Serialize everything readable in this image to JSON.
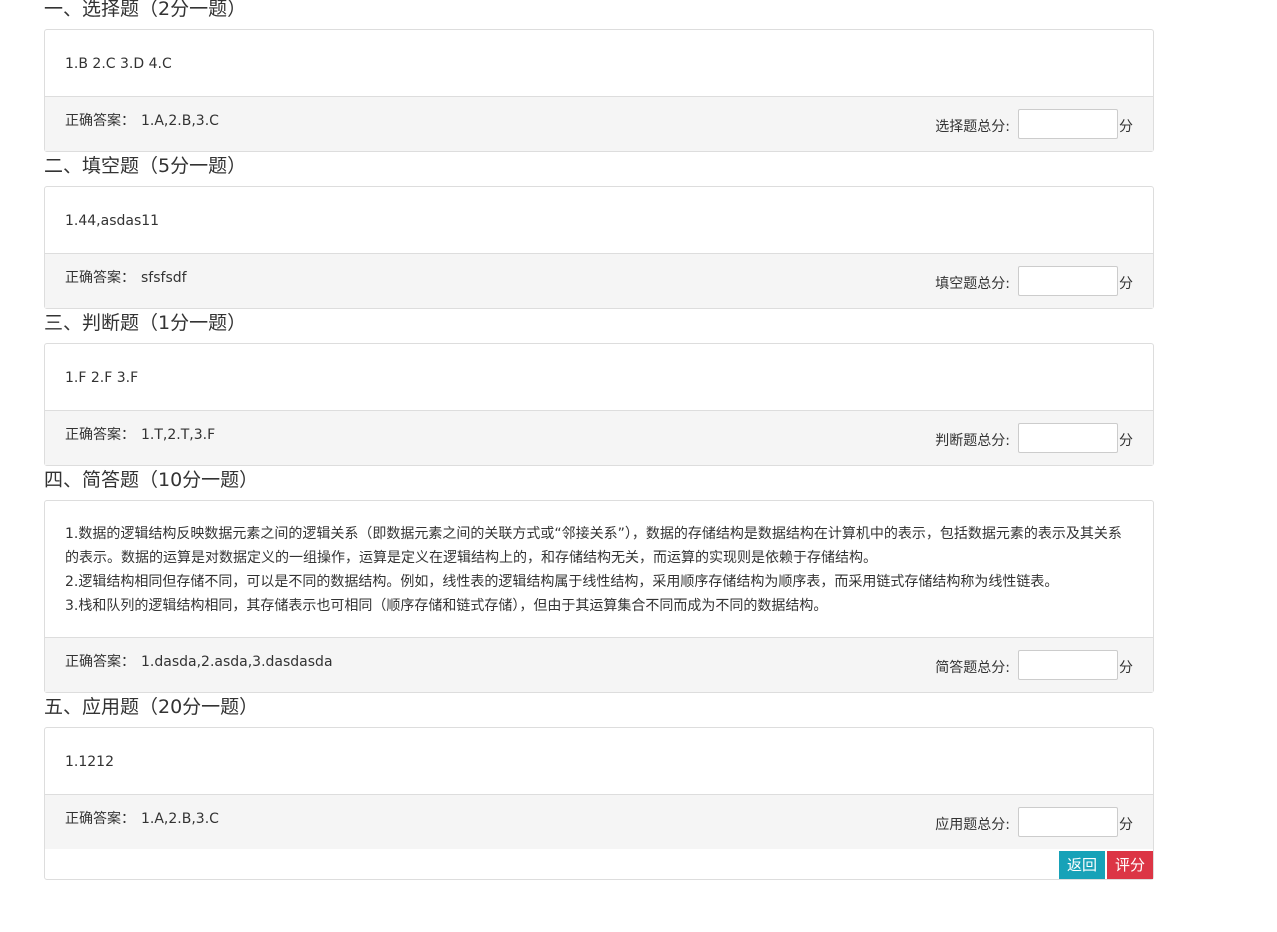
{
  "sections": [
    {
      "title": "一、选择题（2分一题）",
      "body_lines": [
        "1.B 2.C 3.D 4.C"
      ],
      "answer_label": "正确答案：",
      "answer_value": "1.A,2.B,3.C",
      "score_label": "选择题总分:",
      "score_value": "",
      "unit": "分"
    },
    {
      "title": "二、填空题（5分一题）",
      "body_lines": [
        "1.44,asdas11"
      ],
      "answer_label": "正确答案：",
      "answer_value": "sfsfsdf",
      "score_label": "填空题总分:",
      "score_value": "",
      "unit": "分"
    },
    {
      "title": "三、判断题（1分一题）",
      "body_lines": [
        "1.F 2.F 3.F"
      ],
      "answer_label": "正确答案：",
      "answer_value": "1.T,2.T,3.F",
      "score_label": "判断题总分:",
      "score_value": "",
      "unit": "分"
    },
    {
      "title": "四、简答题（10分一题）",
      "body_lines": [
        "1.数据的逻辑结构反映数据元素之间的逻辑关系（即数据元素之间的关联方式或“邻接关系”），数据的存储结构是数据结构在计算机中的表示，包括数据元素的表示及其关系的表示。数据的运算是对数据定义的一组操作，运算是定义在逻辑结构上的，和存储结构无关，而运算的实现则是依赖于存储结构。",
        "2.逻辑结构相同但存储不同，可以是不同的数据结构。例如，线性表的逻辑结构属于线性结构，采用顺序存储结构为顺序表，而采用链式存储结构称为线性链表。",
        "3.栈和队列的逻辑结构相同，其存储表示也可相同（顺序存储和链式存储），但由于其运算集合不同而成为不同的数据结构。"
      ],
      "answer_label": "正确答案：",
      "answer_value": "1.dasda,2.asda,3.dasdasda",
      "score_label": "简答题总分:",
      "score_value": "",
      "unit": "分"
    },
    {
      "title": "五、应用题（20分一题）",
      "body_lines": [
        "1.1212"
      ],
      "answer_label": "正确答案：",
      "answer_value": "1.A,2.B,3.C",
      "score_label": "应用题总分:",
      "score_value": "",
      "unit": "分"
    }
  ],
  "buttons": {
    "back_label": "返回",
    "grade_label": "评分"
  },
  "colors": {
    "back": "#17a2b8",
    "grade": "#dc3545"
  }
}
